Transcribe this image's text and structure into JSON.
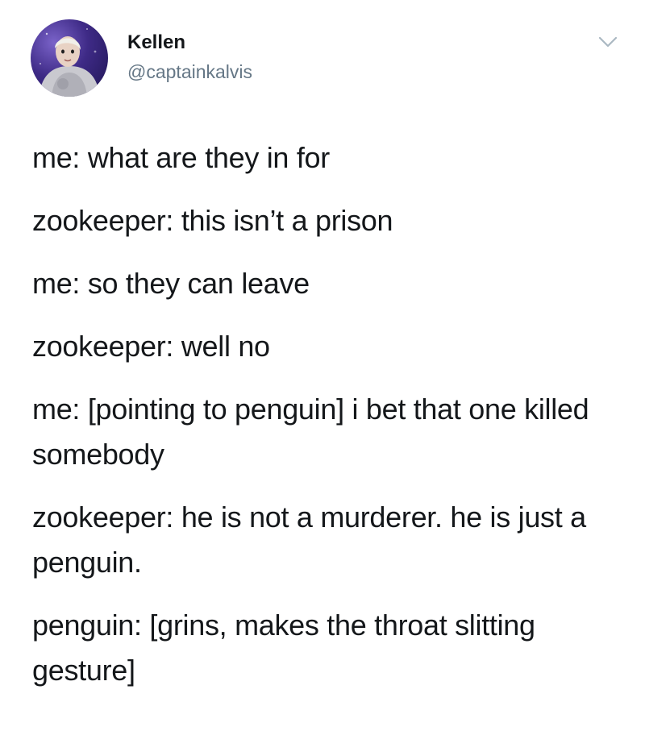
{
  "user": {
    "display_name": "Kellen",
    "handle": "@captainkalvis"
  },
  "icons": {
    "avatar": "profile-photo",
    "menu": "chevron-down-icon"
  },
  "colors": {
    "text": "#14171a",
    "handle": "#657786",
    "chevron": "#aab8c2"
  },
  "tweet": {
    "lines": [
      "me: what are they in for",
      "zookeeper: this isn’t a prison",
      "me: so they can leave",
      "zookeeper: well no",
      "me: [pointing to penguin] i bet that one killed somebody",
      "zookeeper: he is not a murderer. he is just a penguin.",
      "penguin: [grins, makes the throat slitting gesture]"
    ]
  }
}
